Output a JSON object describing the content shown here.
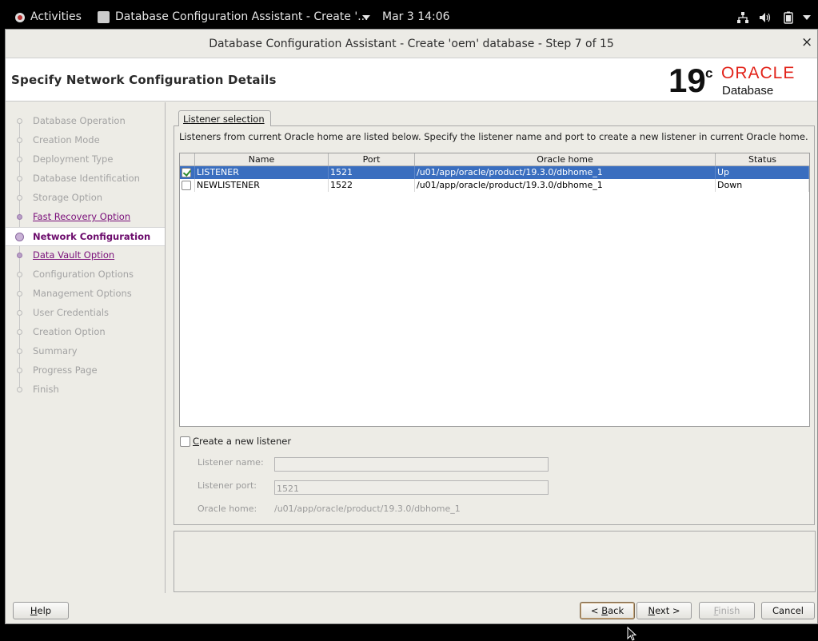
{
  "topbar": {
    "activities": "Activities",
    "app_title": "Database Configuration Assistant - Create '...",
    "clock": "Mar 3  14:06"
  },
  "window": {
    "title": "Database Configuration Assistant - Create 'oem' database - Step 7 of 15",
    "close": "×"
  },
  "header": {
    "title": "Specify Network Configuration Details",
    "logo": {
      "version": "19",
      "superscript": "c",
      "brand": "ORACLE",
      "product": "Database",
      "brand_color": "#e2231a"
    }
  },
  "steps": [
    {
      "label": "Database Operation",
      "state": "disabled"
    },
    {
      "label": "Creation Mode",
      "state": "disabled"
    },
    {
      "label": "Deployment Type",
      "state": "disabled"
    },
    {
      "label": "Database Identification",
      "state": "disabled"
    },
    {
      "label": "Storage Option",
      "state": "disabled"
    },
    {
      "label": "Fast Recovery Option",
      "state": "link"
    },
    {
      "label": "Network Configuration",
      "state": "current"
    },
    {
      "label": "Data Vault Option",
      "state": "link"
    },
    {
      "label": "Configuration Options",
      "state": "disabled"
    },
    {
      "label": "Management Options",
      "state": "disabled"
    },
    {
      "label": "User Credentials",
      "state": "disabled"
    },
    {
      "label": "Creation Option",
      "state": "disabled"
    },
    {
      "label": "Summary",
      "state": "disabled"
    },
    {
      "label": "Progress Page",
      "state": "disabled"
    },
    {
      "label": "Finish",
      "state": "disabled"
    }
  ],
  "tab": {
    "label": "Listener selection"
  },
  "info_text": "Listeners from current Oracle home are listed below. Specify the listener name and port to create a new listener in current Oracle home.",
  "table": {
    "columns": [
      "Name",
      "Port",
      "Oracle home",
      "Status"
    ],
    "rows": [
      {
        "checked": true,
        "selected": true,
        "name": "LISTENER",
        "port": "1521",
        "home": "/u01/app/oracle/product/19.3.0/dbhome_1",
        "status": "Up"
      },
      {
        "checked": false,
        "selected": false,
        "name": "NEWLISTENER",
        "port": "1522",
        "home": "/u01/app/oracle/product/19.3.0/dbhome_1",
        "status": "Down"
      }
    ]
  },
  "new_listener": {
    "checkbox_label": "Create a new listener",
    "checked": false,
    "name_label": "Listener name:",
    "name_value": "",
    "port_label": "Listener port:",
    "port_value": "1521",
    "home_label": "Oracle home:",
    "home_value": "/u01/app/oracle/product/19.3.0/dbhome_1"
  },
  "buttons": {
    "help": "Help",
    "back": "< Back",
    "next": "Next >",
    "finish": "Finish",
    "cancel": "Cancel"
  }
}
